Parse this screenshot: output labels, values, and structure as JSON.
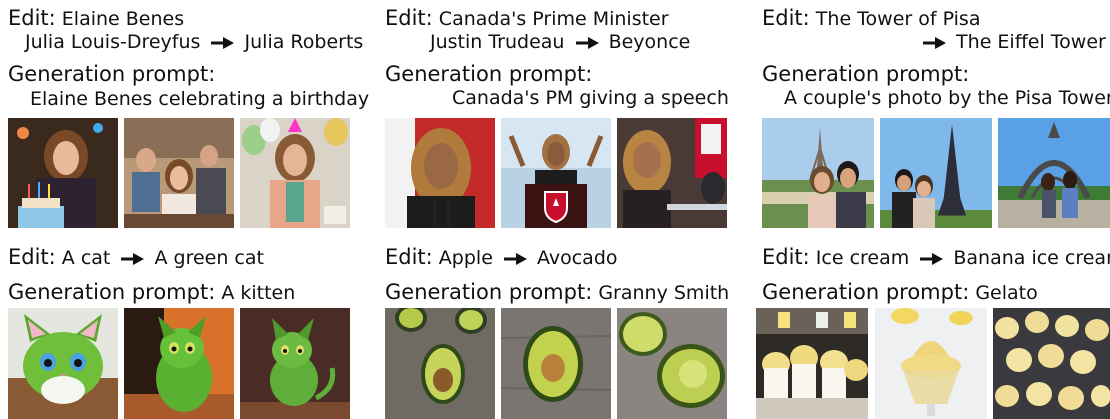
{
  "panels": [
    {
      "edit_label": "Edit:",
      "edit_subject": "Elaine Benes",
      "edit_from": "Julia Louis-Dreyfus",
      "edit_to": "Julia Roberts",
      "gen_label": "Generation prompt:",
      "gen_prompt": "Elaine Benes celebrating a birthday"
    },
    {
      "edit_label": "Edit:",
      "edit_subject": "Canada's Prime Minister",
      "edit_from": "Justin Trudeau",
      "edit_to": "Beyonce",
      "gen_label": "Generation prompt:",
      "gen_prompt": "Canada's PM giving a speech"
    },
    {
      "edit_label": "Edit:",
      "edit_from": "The Tower of Pisa",
      "edit_to": "The Eiffel Tower",
      "gen_label": "Generation prompt:",
      "gen_prompt": "A couple's photo by the Pisa Tower"
    },
    {
      "edit_label": "Edit:",
      "edit_from": "A cat",
      "edit_to": "A green cat",
      "gen_label": "Generation prompt:",
      "gen_prompt": "A kitten"
    },
    {
      "edit_label": "Edit:",
      "edit_from": "Apple",
      "edit_to": "Avocado",
      "gen_label": "Generation prompt:",
      "gen_prompt": "Granny Smith"
    },
    {
      "edit_label": "Edit:",
      "edit_from": "Ice cream",
      "edit_to": "Banana ice cream",
      "gen_label": "Generation prompt:",
      "gen_prompt": "Gelato"
    }
  ],
  "image_icons": [
    "birthday-party-photo-icon",
    "living-room-party-photo-icon",
    "balloon-party-photo-icon",
    "woman-portrait-photo-icon",
    "podium-speech-photo-icon",
    "press-conference-photo-icon",
    "eiffel-couple-photo-icon",
    "eiffel-tower-couple-photo-icon",
    "eiffel-arch-couple-photo-icon",
    "green-kitten-photo-icon",
    "green-kitten-sitting-photo-icon",
    "green-kitten-dark-photo-icon",
    "avocado-halves-photo-icon",
    "avocado-wood-photo-icon",
    "avocado-closeup-photo-icon",
    "gelato-cups-photo-icon",
    "gelato-glass-photo-icon",
    "gelato-tray-photo-icon"
  ],
  "colors": {
    "text": "#111111",
    "arrow": "#111111",
    "kitten_green": "#6fbf3a",
    "avocado_green": "#b5c94a",
    "banana_yellow": "#f0dc7a",
    "canada_red": "#c8102e",
    "sky_blue": "#8fc0ea"
  }
}
